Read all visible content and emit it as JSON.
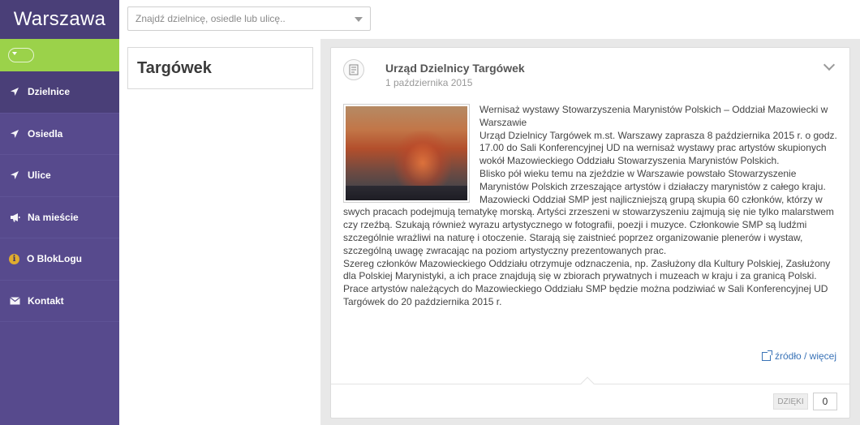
{
  "sidebar": {
    "brand": "Warszawa",
    "items": [
      {
        "label": "Dzielnice",
        "icon": "location-arrow-icon",
        "active": true
      },
      {
        "label": "Osiedla",
        "icon": "location-arrow-icon",
        "active": false
      },
      {
        "label": "Ulice",
        "icon": "location-arrow-icon",
        "active": false
      },
      {
        "label": "Na mieście",
        "icon": "bullhorn-icon",
        "active": false
      },
      {
        "label": "O BlokLogu",
        "icon": "info-circle-icon",
        "active": false
      },
      {
        "label": "Kontakt",
        "icon": "envelope-icon",
        "active": false
      }
    ]
  },
  "search": {
    "placeholder": "Znajdź dzielnicę, osiedle lub ulicę.."
  },
  "district": {
    "title": "Targówek"
  },
  "post": {
    "author": "Urząd Dzielnicy Targówek",
    "date": "1 października 2015",
    "paragraphs": [
      "Wernisaż wystawy Stowarzyszenia Marynistów Polskich – Oddział Mazowiecki w Warszawie",
      "Urząd Dzielnicy Targówek m.st. Warszawy zaprasza 8 października 2015 r. o godz. 17.00 do Sali Konferencyjnej UD na wernisaż wystawy prac artystów skupionych wokół Mazowieckiego Oddziału Stowarzyszenia Marynistów Polskich.",
      "Blisko pół wieku temu na zjeździe w Warszawie powstało Stowarzyszenie Marynistów Polskich zrzeszające artystów i działaczy marynistów z całego kraju. Mazowiecki Oddział SMP jest najliczniejszą grupą skupia 60 członków, którzy w swych pracach podejmują tematykę morską. Artyści zrzeszeni w stowarzyszeniu zajmują się nie tylko malarstwem czy rzeźbą. Szukają również wyrazu artystycznego w fotografii, poezji i muzyce. Członkowie SMP są ludźmi szczególnie wrażliwi na naturę i otoczenie. Starają się zaistnieć poprzez organizowanie plenerów i wystaw, szczególną uwagę zwracając na poziom artystyczny prezentowanych prac.",
      "Szereg członków Mazowieckiego Oddziału otrzymuje odznaczenia, np. Zasłużony dla Kultury Polskiej, Zasłużony dla Polskiej Marynistyki, a ich prace znajdują się w zbiorach prywatnych i muzeach w kraju i za granicą Polski.",
      "Prace artystów należących do Mazowieckiego Oddziału SMP będzie można podziwiać w Sali Konferencyjnej UD Targówek do 20 października 2015 r."
    ],
    "source_link": "źródło / więcej",
    "thanks_label": "DZIĘKI",
    "thanks_count": "0"
  },
  "colors": {
    "sidebar": "#574a8d",
    "sidebar_dark": "#4a3f78",
    "accent_green": "#9bd24a",
    "link": "#3a73b7"
  }
}
